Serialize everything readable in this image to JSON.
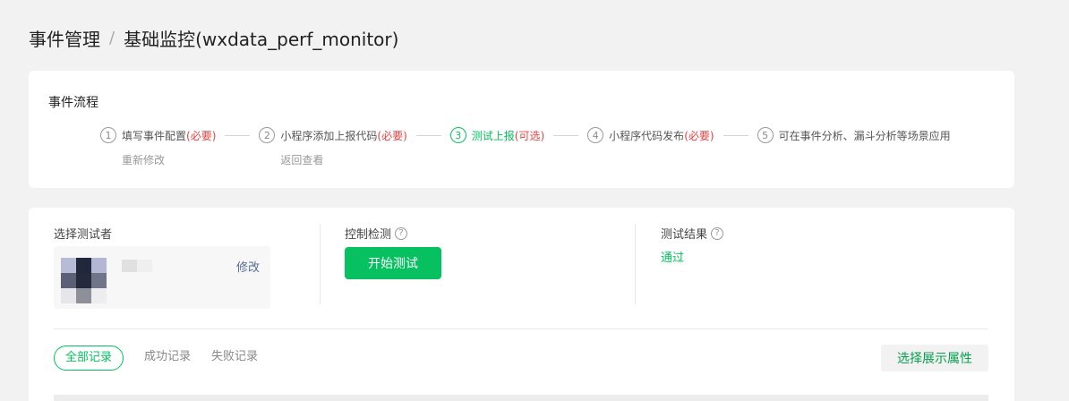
{
  "breadcrumb": {
    "parent": "事件管理",
    "separator": "/",
    "current": "基础监控(wxdata_perf_monitor)"
  },
  "flow": {
    "title": "事件流程",
    "steps": [
      {
        "num": "1",
        "label": "填写事件配置 ",
        "required": "(必要)",
        "sub": "重新修改",
        "active": false
      },
      {
        "num": "2",
        "label": "小程序添加上报代码",
        "required": "(必要)",
        "sub": "返回查看",
        "active": false
      },
      {
        "num": "3",
        "label": "测试上报",
        "required": "(可选)",
        "sub": "",
        "active": true
      },
      {
        "num": "4",
        "label": "小程序代码发布",
        "required": "(必要)",
        "sub": "",
        "active": false
      },
      {
        "num": "5",
        "label": "可在事件分析、漏斗分析等场景应用",
        "required": "",
        "sub": "",
        "active": false
      }
    ]
  },
  "tester": {
    "title": "选择测试者",
    "modify_label": "修改"
  },
  "control": {
    "title": "控制检测",
    "help": "?",
    "start_label": "开始测试"
  },
  "result": {
    "title": "测试结果",
    "help": "?",
    "value": "通过"
  },
  "records": {
    "tabs": [
      "全部记录",
      "成功记录",
      "失败记录"
    ],
    "attrs_label": "选择展示属性"
  },
  "colors": {
    "accent": "#07c160",
    "required": "#e64340",
    "link": "#576b95"
  }
}
